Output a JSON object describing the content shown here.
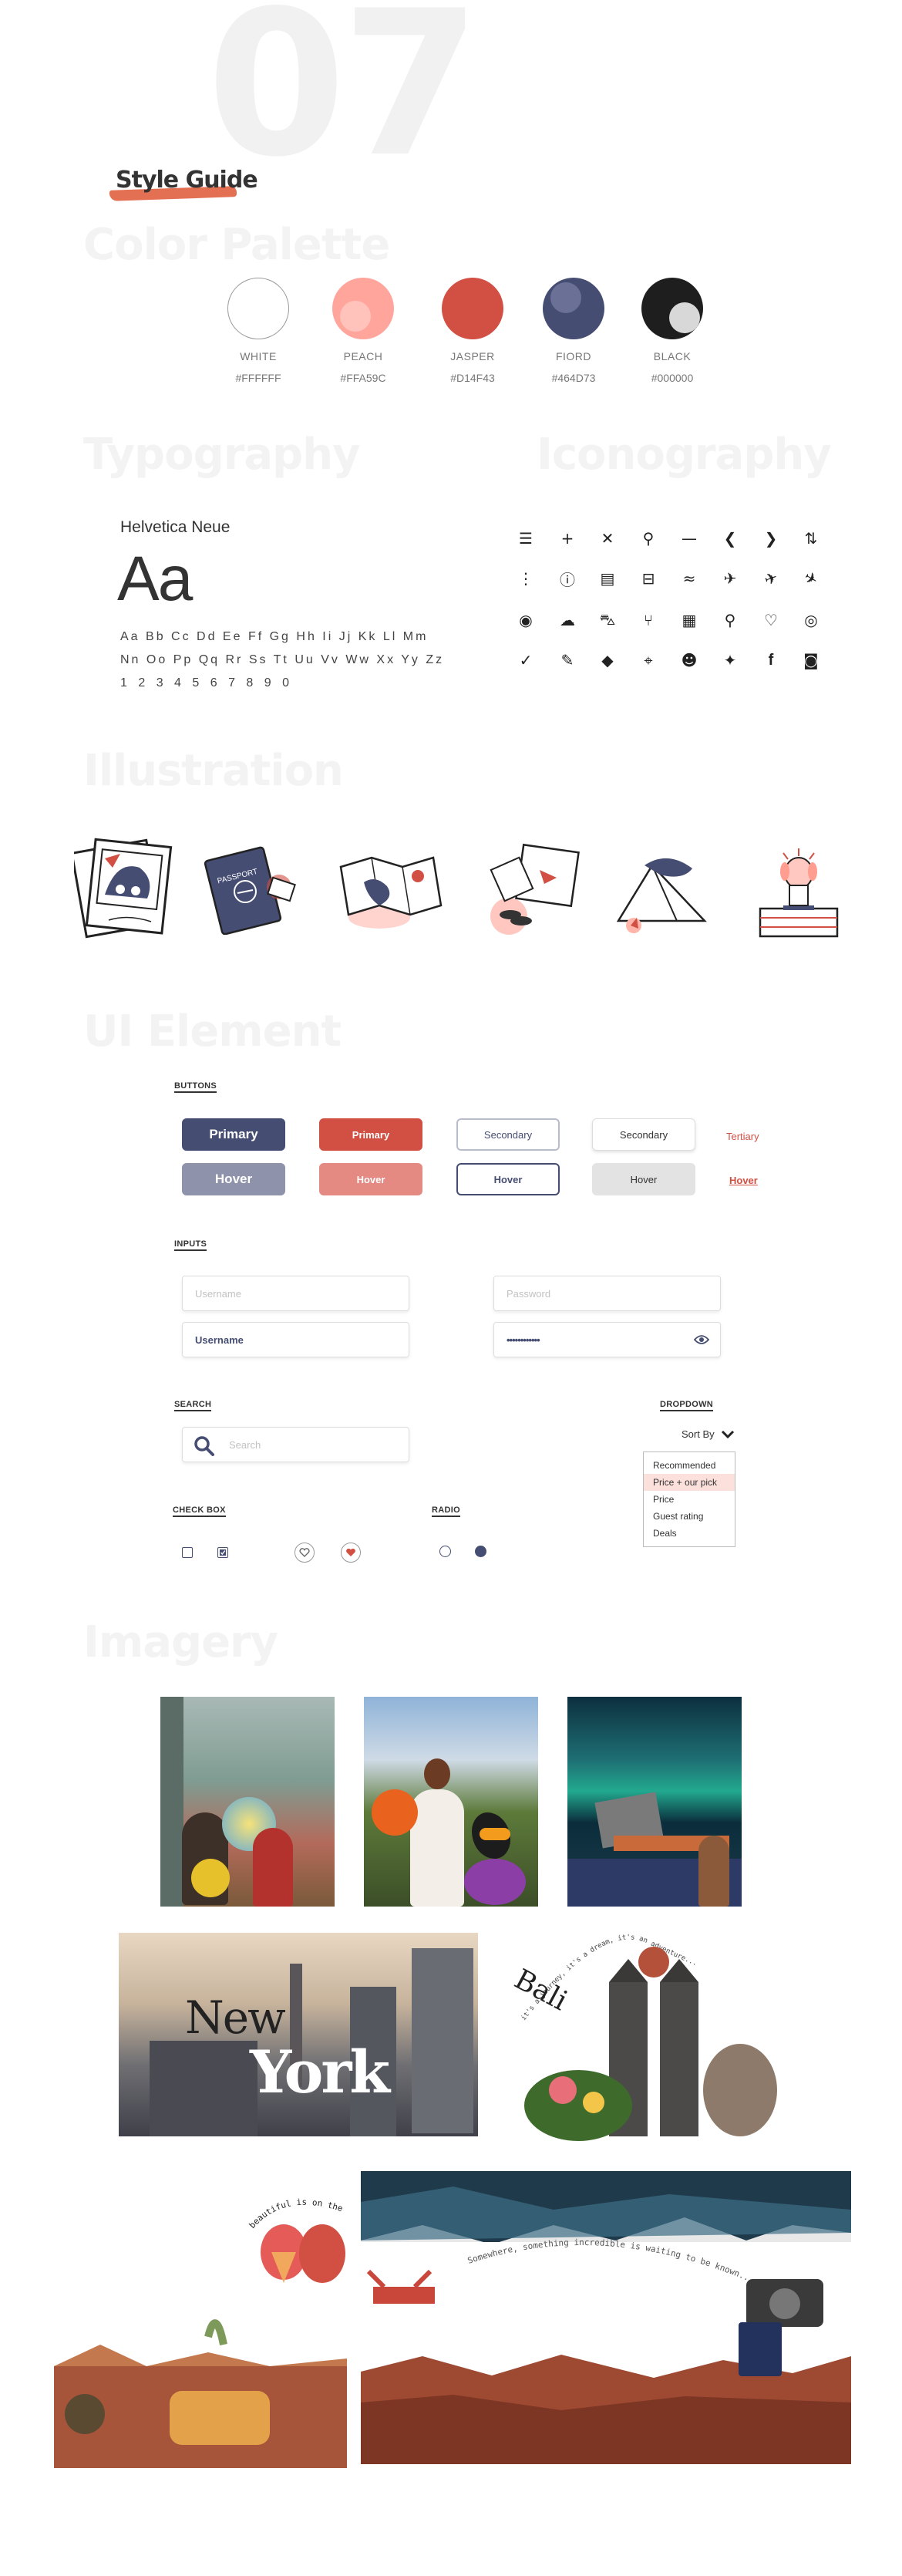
{
  "header": {
    "number": "07",
    "title": "Style Guide"
  },
  "sections": {
    "color_palette": "Color Palette",
    "typography": "Typography",
    "iconography": "Iconography",
    "illustration": "Illustration",
    "ui_element": "UI Element",
    "imagery": "Imagery"
  },
  "colors": {
    "white": {
      "name": "WHITE",
      "hex": "#FFFFFF",
      "value": "#ffffff"
    },
    "peach": {
      "name": "PEACH",
      "hex": "#FFA59C",
      "value": "#ffa59c"
    },
    "jasper": {
      "name": "JASPER",
      "hex": "#D14F43",
      "value": "#d14f43"
    },
    "fiord": {
      "name": "FIORD",
      "hex": "#464D73",
      "value": "#464d73"
    },
    "black": {
      "name": "BLACK",
      "hex": "#000000",
      "value": "#000000"
    }
  },
  "typography": {
    "font_name": "Helvetica Neue",
    "sample": "Aa",
    "alphabet_1": "Aa Bb Cc Dd Ee Ff Gg Hh Ii Jj Kk Ll Mm",
    "alphabet_2": "Nn Oo Pp Qq Rr Ss Tt Uu Vv Ww Xx Yy Zz",
    "digits": "1 2 3 4 5 6 7 8 9 0"
  },
  "icons": [
    "menu-icon",
    "plus-icon",
    "close-icon",
    "search-icon",
    "minus-icon",
    "chevron-left-icon",
    "chevron-right-icon",
    "sort-arrows-icon",
    "more-vertical-icon",
    "info-icon",
    "document-icon",
    "bed-icon",
    "swim-icon",
    "plane-icon",
    "plane-takeoff-icon",
    "plane-landing-icon",
    "user-circle-icon",
    "cloud-icon",
    "car-icon",
    "dining-icon",
    "calendar-icon",
    "pin-board-icon",
    "heart-icon",
    "eye-icon",
    "check-icon",
    "pencil-icon",
    "directions-icon",
    "location-icon",
    "emoji-icon",
    "twitter-icon",
    "facebook-icon",
    "instagram-icon"
  ],
  "ui": {
    "buttons_label": "BUTTONS",
    "primary": "Primary",
    "hover": "Hover",
    "secondary": "Secondary",
    "tertiary": "Tertiary",
    "inputs_label": "INPUTS",
    "username_placeholder": "Username",
    "password_placeholder": "Password",
    "username_value": "Username",
    "password_value": "••••••••••••",
    "search_label": "SEARCH",
    "search_placeholder": "Search",
    "dropdown_label": "DROPDOWN",
    "sort_by": "Sort By",
    "dropdown_options": [
      "Recommended",
      "Price + our pick",
      "Price",
      "Guest rating",
      "Deals"
    ],
    "checkbox_label": "CHECK BOX",
    "radio_label": "RADIO"
  },
  "imagery": {
    "new": "New",
    "york": "York",
    "bali": "Bali",
    "bali_curve": "it's a journey, it's a dream, it's an adventure...",
    "horizon_curve": "beautiful is on the horizon",
    "quote_curve": "Somewhere, something incredible is waiting to be known..."
  },
  "accent_colors": {
    "fiord": "#464d73",
    "jasper": "#d14f43",
    "peach": "#ffa59c",
    "brush": "#e0603f"
  }
}
